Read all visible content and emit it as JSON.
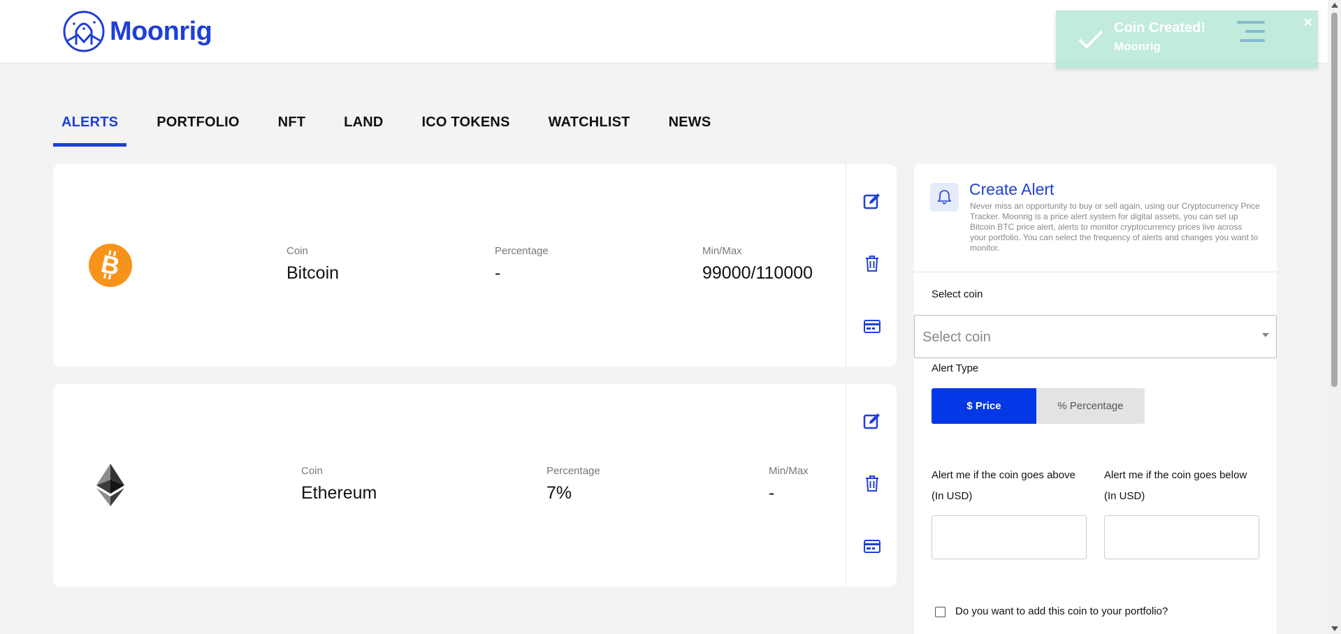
{
  "header": {
    "brand": "Moonrig"
  },
  "toast": {
    "title": "Coin Created!",
    "subtitle": "Moonrig",
    "close": "×"
  },
  "tabs": [
    {
      "label": "ALERTS",
      "active": true
    },
    {
      "label": "PORTFOLIO",
      "active": false
    },
    {
      "label": "NFT",
      "active": false
    },
    {
      "label": "LAND",
      "active": false
    },
    {
      "label": "ICO TOKENS",
      "active": false
    },
    {
      "label": "WATCHLIST",
      "active": false
    },
    {
      "label": "NEWS",
      "active": false
    }
  ],
  "alerts": [
    {
      "coin_label": "Coin",
      "coin": "Bitcoin",
      "percentage_label": "Percentage",
      "percentage": "-",
      "minmax_label": "Min/Max",
      "minmax": "99000/110000",
      "icon": "bitcoin-logo",
      "color": "#f7931a"
    },
    {
      "coin_label": "Coin",
      "coin": "Ethereum",
      "percentage_label": "Percentage",
      "percentage": "7%",
      "minmax_label": "Min/Max",
      "minmax": "-",
      "icon": "ethereum-logo"
    }
  ],
  "create_alert": {
    "title": "Create Alert",
    "description": "Never miss an opportunity to buy or sell again, using our Cryptocurrency Price Tracker. Moonrig is a price alert system for digital assets, you can set up Bitcoin BTC price alert, alerts to monitor cryptocurrency prices live across your portfolio. You can select the frequency of alerts and changes you want to monitor.",
    "select_coin_label": "Select coin",
    "select_coin_placeholder": "Select coin",
    "alert_type_label": "Alert Type",
    "price_button": "$ Price",
    "percentage_button": "% Percentage",
    "above_label": "Alert me if the coin goes above",
    "above_unit": "(In USD)",
    "below_label": "Alert me if the coin goes below",
    "below_unit": "(In USD)",
    "portfolio_checkbox_label": "Do you want to add this coin to your portfolio?"
  },
  "colors": {
    "accent": "#1f3fd6",
    "primary_button": "#0437e6",
    "toast_bg": "#ace4cd",
    "bitcoin": "#f7931a"
  }
}
